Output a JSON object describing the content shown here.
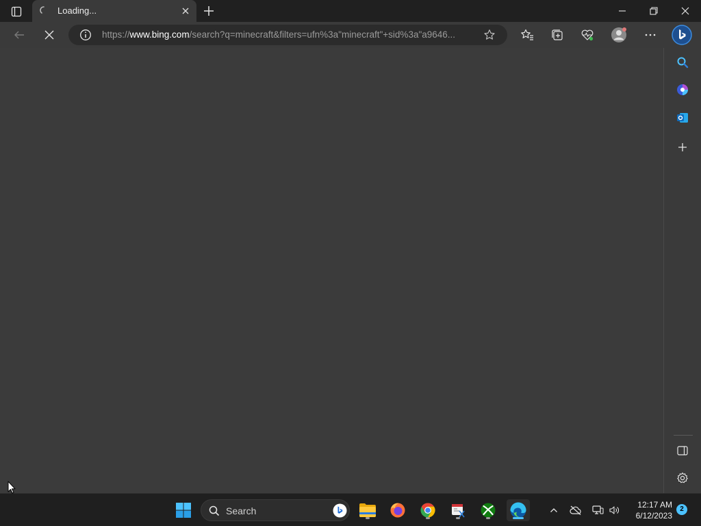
{
  "browser": {
    "tab": {
      "title": "Loading..."
    },
    "address": {
      "url_prefix": "https://",
      "url_host": "www.bing.com",
      "url_rest": "/search?q=minecraft&filters=ufn%3a\"minecraft\"+sid%3a\"a9646..."
    }
  },
  "taskbar": {
    "search_label": "Search",
    "clock_time": "12:17 AM",
    "clock_date": "6/12/2023",
    "notification_count": "2"
  },
  "colors": {
    "accent": "#4cc2ff",
    "content_bg": "#3b3b3b",
    "chrome_bg": "#202020"
  }
}
